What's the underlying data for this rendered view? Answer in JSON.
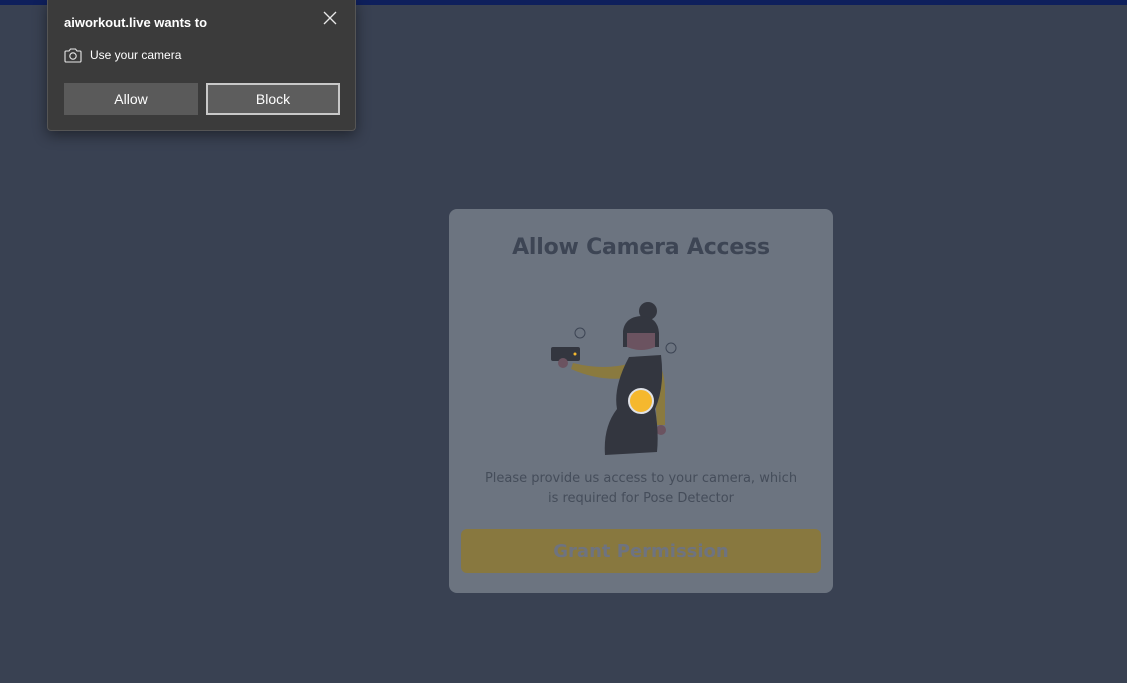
{
  "permission_prompt": {
    "title": "aiworkout.live wants to",
    "permission_label": "Use your camera",
    "allow_label": "Allow",
    "block_label": "Block",
    "icons": {
      "close": "close-icon",
      "permission": "camera-icon"
    }
  },
  "card": {
    "title": "Allow Camera Access",
    "description": "Please provide us access to your camera, which is required for Pose Detector",
    "button_label": "Grant Permission"
  },
  "colors": {
    "page_background": "#394152",
    "card_background": "#6c7480",
    "button_background": "#88783f",
    "accent_yellow": "#f5b82e",
    "prompt_background": "#3b3b3b"
  }
}
